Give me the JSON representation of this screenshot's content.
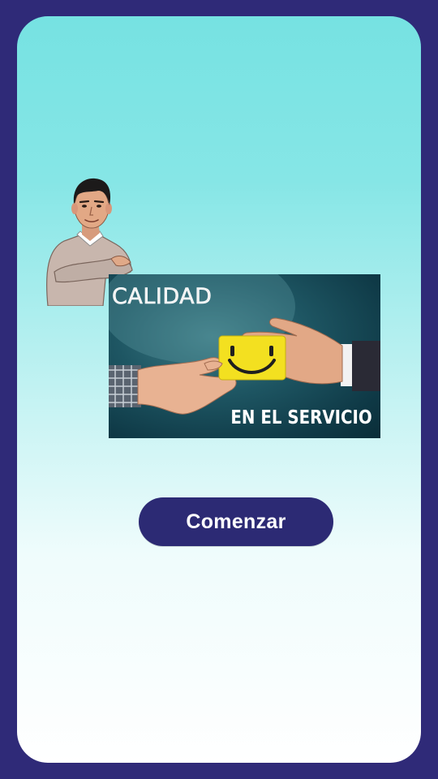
{
  "colors": {
    "frame": "#2f2a78",
    "card_top": "#76e2e2",
    "card_bottom": "#ffffff",
    "button": "#2c2a74",
    "smiley_card": "#f3e020"
  },
  "banner": {
    "title": "CALIDAD",
    "subtitle": "EN EL SERVICIO",
    "image_icon": "smiley-card-icon"
  },
  "avatar": {
    "icon": "cartoon-man-avatar"
  },
  "actions": {
    "start_label": "Comenzar"
  }
}
